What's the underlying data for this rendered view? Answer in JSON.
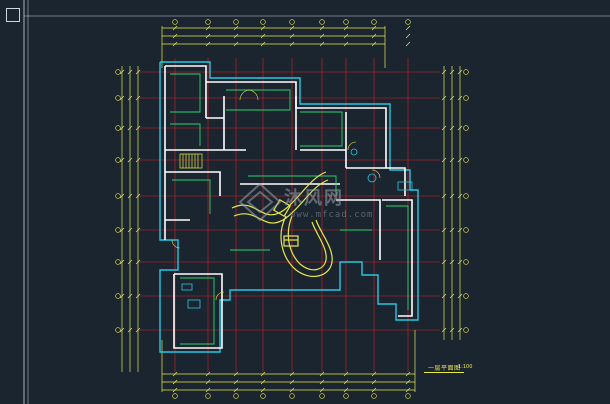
{
  "drawing": {
    "title": "一层平面图",
    "scale": "1:100"
  },
  "watermark": {
    "brand": "沐风网",
    "url": "www.mfcad.com"
  },
  "colors": {
    "background": "#1b2530",
    "walls": "#ffffff",
    "axis_grid": "#d81e1e",
    "dimensions": "#e8e84a",
    "inner_walls": "#2ad46a",
    "outline_cyan": "#27c7e0",
    "text_yellow": "#e8e84a"
  },
  "icons": {
    "ucs": "ucs-icon",
    "watermark_logo": "logo-icon"
  }
}
